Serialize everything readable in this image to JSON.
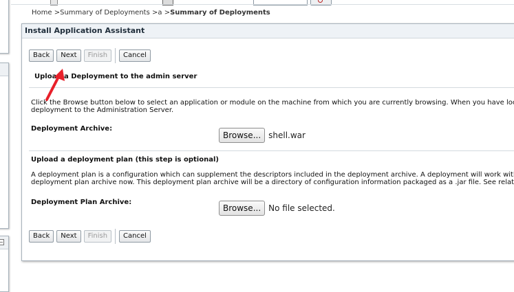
{
  "breadcrumb": {
    "home": "Home",
    "summary_deployments": "Summary of Deployments",
    "a": "a",
    "current": "Summary of Deployments",
    "sep": ">"
  },
  "panel": {
    "title": "Install Application Assistant"
  },
  "buttons": {
    "back": "Back",
    "next": "Next",
    "finish": "Finish",
    "cancel": "Cancel"
  },
  "upload_deployment": {
    "heading": "Upload a Deployment to the admin server",
    "description_line1": "Click the Browse button below to select an application or module on the machine from which you are currently browsing. When you have located",
    "description_line2": "deployment to the Administration Server.",
    "archive_label": "Deployment Archive:",
    "browse_label": "Browse...",
    "selected_file": "shell.war"
  },
  "upload_plan": {
    "heading": "Upload a deployment plan (this step is optional)",
    "description_line1": "A deployment plan is a configuration which can supplement the descriptors included in the deployment archive. A deployment will work without a",
    "description_line2": "deployment plan archive now. This deployment plan archive will be a directory of configuration information packaged as a .jar file. See related lin",
    "archive_label": "Deployment Plan Archive:",
    "browse_label": "Browse...",
    "selected_file": "No file selected."
  },
  "colors": {
    "panel_title_bg": "#eef2f6",
    "annotation_arrow": "#e8202a"
  },
  "icons": {
    "top_go": "search-icon",
    "sidebar_collapse": "collapse-icon",
    "annotation": "red-arrow-icon"
  }
}
